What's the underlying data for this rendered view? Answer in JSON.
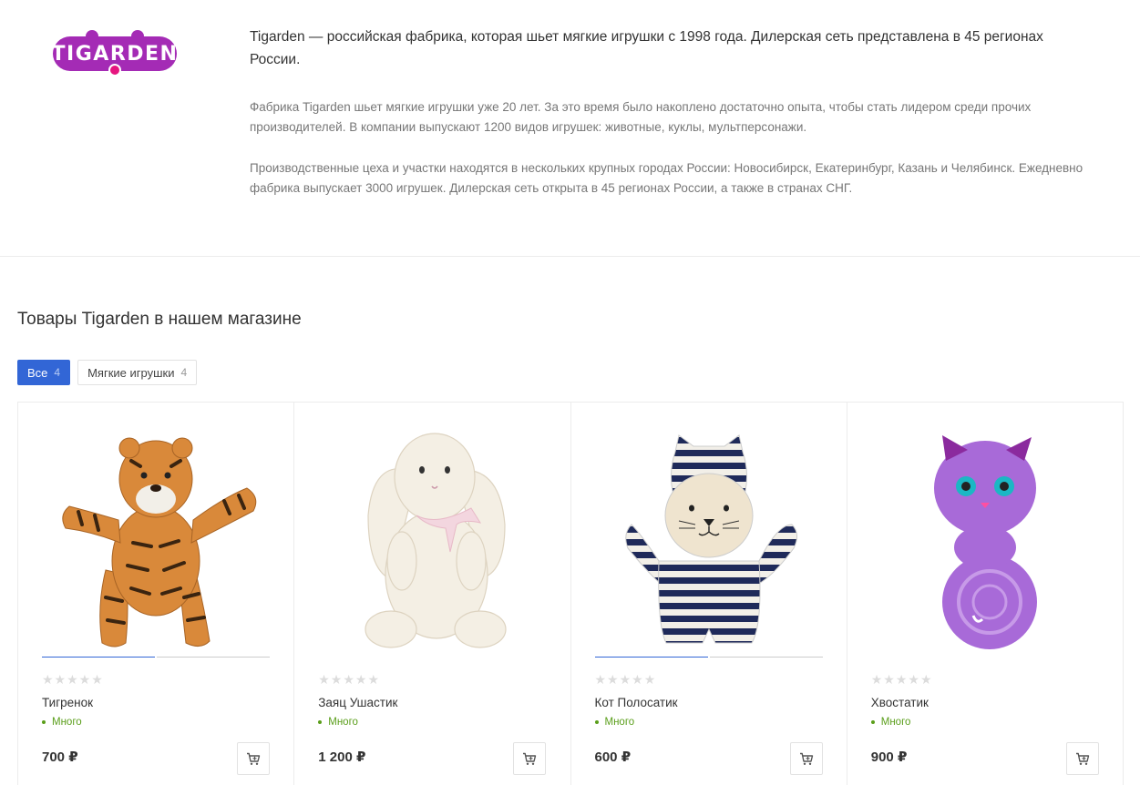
{
  "brand": {
    "logo_text": "TIGARDEN",
    "lead": "Tigarden — российская фабрика, которая шьет мягкие игрушки с 1998 года. Дилерская сеть представлена в 45 регионах России.",
    "paragraph1": "Фабрика Tigarden шьет мягкие игрушки уже 20 лет. За это время было накоплено достаточно опыта, чтобы стать лидером среди прочих производителей. В компании выпускают 1200 видов игрушек: животные, куклы, мультперсонажи.",
    "paragraph2": "Производственные цеха и участки находятся в нескольких крупных городах России: Новосибирск, Екатеринбург, Казань и Челябинск. Ежедневно фабрика выпускает 3000 игрушек. Дилерская сеть открыта в 45 регионах России, а также в странах СНГ."
  },
  "section": {
    "title": "Товары Tigarden в нашем магазине"
  },
  "tabs": [
    {
      "label": "Все",
      "count": "4",
      "active": true
    },
    {
      "label": "Мягкие игрушки",
      "count": "4",
      "active": false
    }
  ],
  "products": [
    {
      "name": "Тигренок",
      "stock": "Много",
      "price": "700 ₽",
      "image_icon": "tiger-toy-image",
      "rating": 0,
      "slides": 2
    },
    {
      "name": "Заяц Ушастик",
      "stock": "Много",
      "price": "1 200 ₽",
      "image_icon": "bunny-toy-image",
      "rating": 0,
      "slides": 0
    },
    {
      "name": "Кот Полосатик",
      "stock": "Много",
      "price": "600 ₽",
      "image_icon": "striped-cat-toy-image",
      "rating": 0,
      "slides": 2
    },
    {
      "name": "Хвостатик",
      "stock": "Много",
      "price": "900 ₽",
      "image_icon": "purple-cat-toy-image",
      "rating": 0,
      "slides": 0
    }
  ],
  "colors": {
    "brand_purple": "#a42bb5",
    "brand_pink": "#e6157f",
    "accent_blue": "#3266d6",
    "stock_green": "#5a9e1a"
  }
}
